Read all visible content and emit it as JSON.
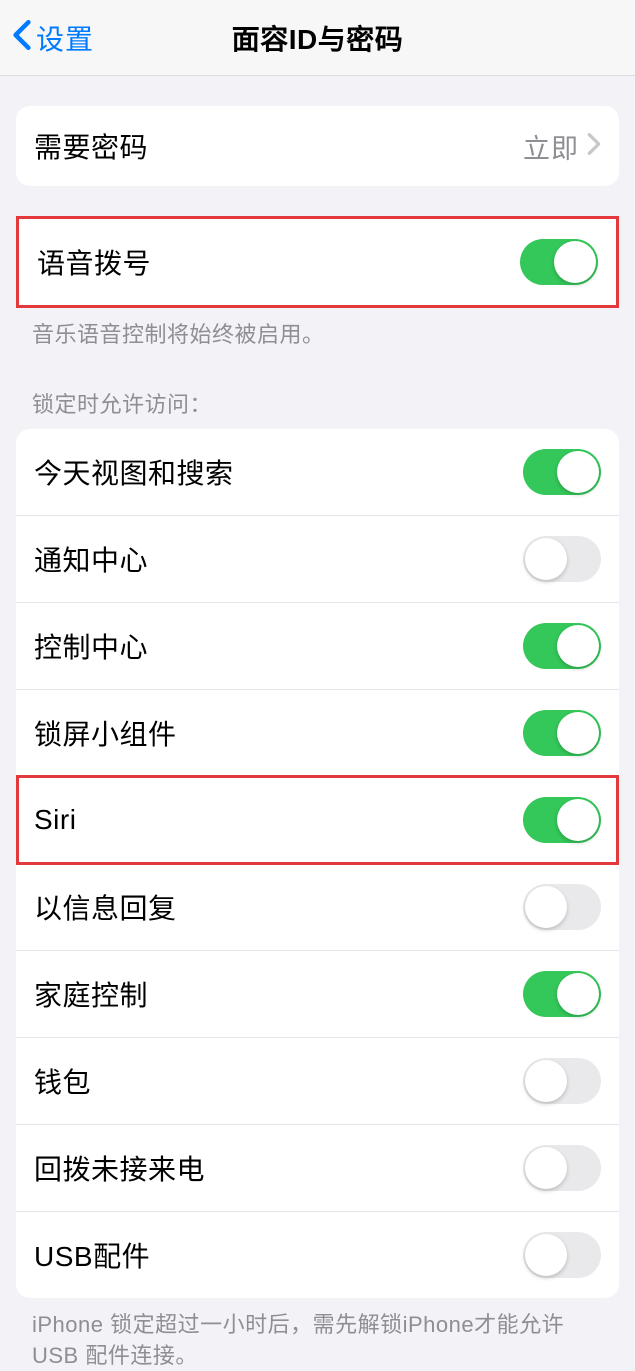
{
  "nav": {
    "back_label": "设置",
    "title": "面容ID与密码"
  },
  "require_passcode": {
    "label": "需要密码",
    "value": "立即"
  },
  "voice_dial": {
    "label": "语音拨号",
    "footer": "音乐语音控制将始终被启用。"
  },
  "lock_access": {
    "header": "锁定时允许访问：",
    "items": [
      {
        "label": "今天视图和搜索",
        "on": true
      },
      {
        "label": "通知中心",
        "on": false
      },
      {
        "label": "控制中心",
        "on": true
      },
      {
        "label": "锁屏小组件",
        "on": true
      },
      {
        "label": "Siri",
        "on": true
      },
      {
        "label": "以信息回复",
        "on": false
      },
      {
        "label": "家庭控制",
        "on": true
      },
      {
        "label": "钱包",
        "on": false
      },
      {
        "label": "回拨未接来电",
        "on": false
      },
      {
        "label": "USB配件",
        "on": false
      }
    ],
    "footer": "iPhone 锁定超过一小时后，需先解锁iPhone才能允许USB 配件连接。"
  }
}
